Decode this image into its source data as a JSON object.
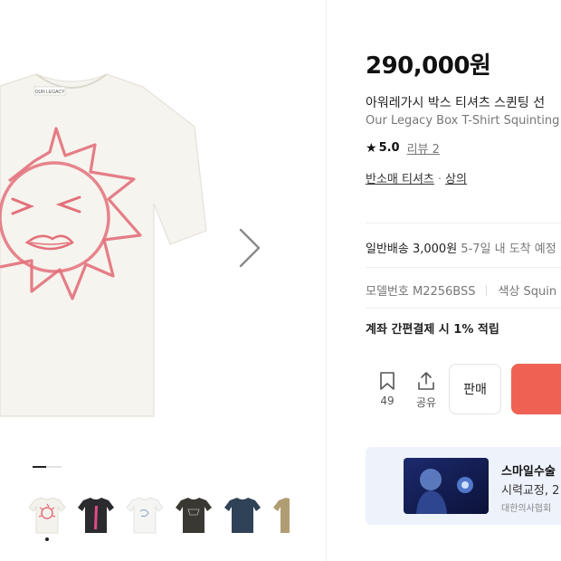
{
  "product": {
    "price": "290,000원",
    "title_ko": "아워레가시 박스 티셔츠 스퀸팅 선",
    "title_en": "Our Legacy Box T-Shirt Squinting S",
    "rating_score": "5.0",
    "review_label": "리뷰 2",
    "category": [
      "반소매 티셔츠",
      "상의"
    ],
    "category_separator": "·",
    "shipping_label": "일반배송 3,000원",
    "shipping_eta": "5-7일 내 도착 예정",
    "model_label": "모델번호 M2256BSS",
    "color_label": "색상 Squin",
    "payment_promo": "계좌 간편결제 시 1% 적립"
  },
  "actions": {
    "bookmark_count": "49",
    "share_label": "공유",
    "sell_label": "판매",
    "accent": "#ef6253"
  },
  "gallery": {
    "tag_text": "OUR LEGACY",
    "thumbnails": [
      "sun-print-white",
      "pink-figure-black",
      "white-graphic",
      "black-graphic",
      "navy-tee",
      "khaki-tee"
    ],
    "active_index": 0
  },
  "ad": {
    "title": "스마일수술",
    "subtitle": "시력교정, 2",
    "footnote": "대한의사협회"
  }
}
